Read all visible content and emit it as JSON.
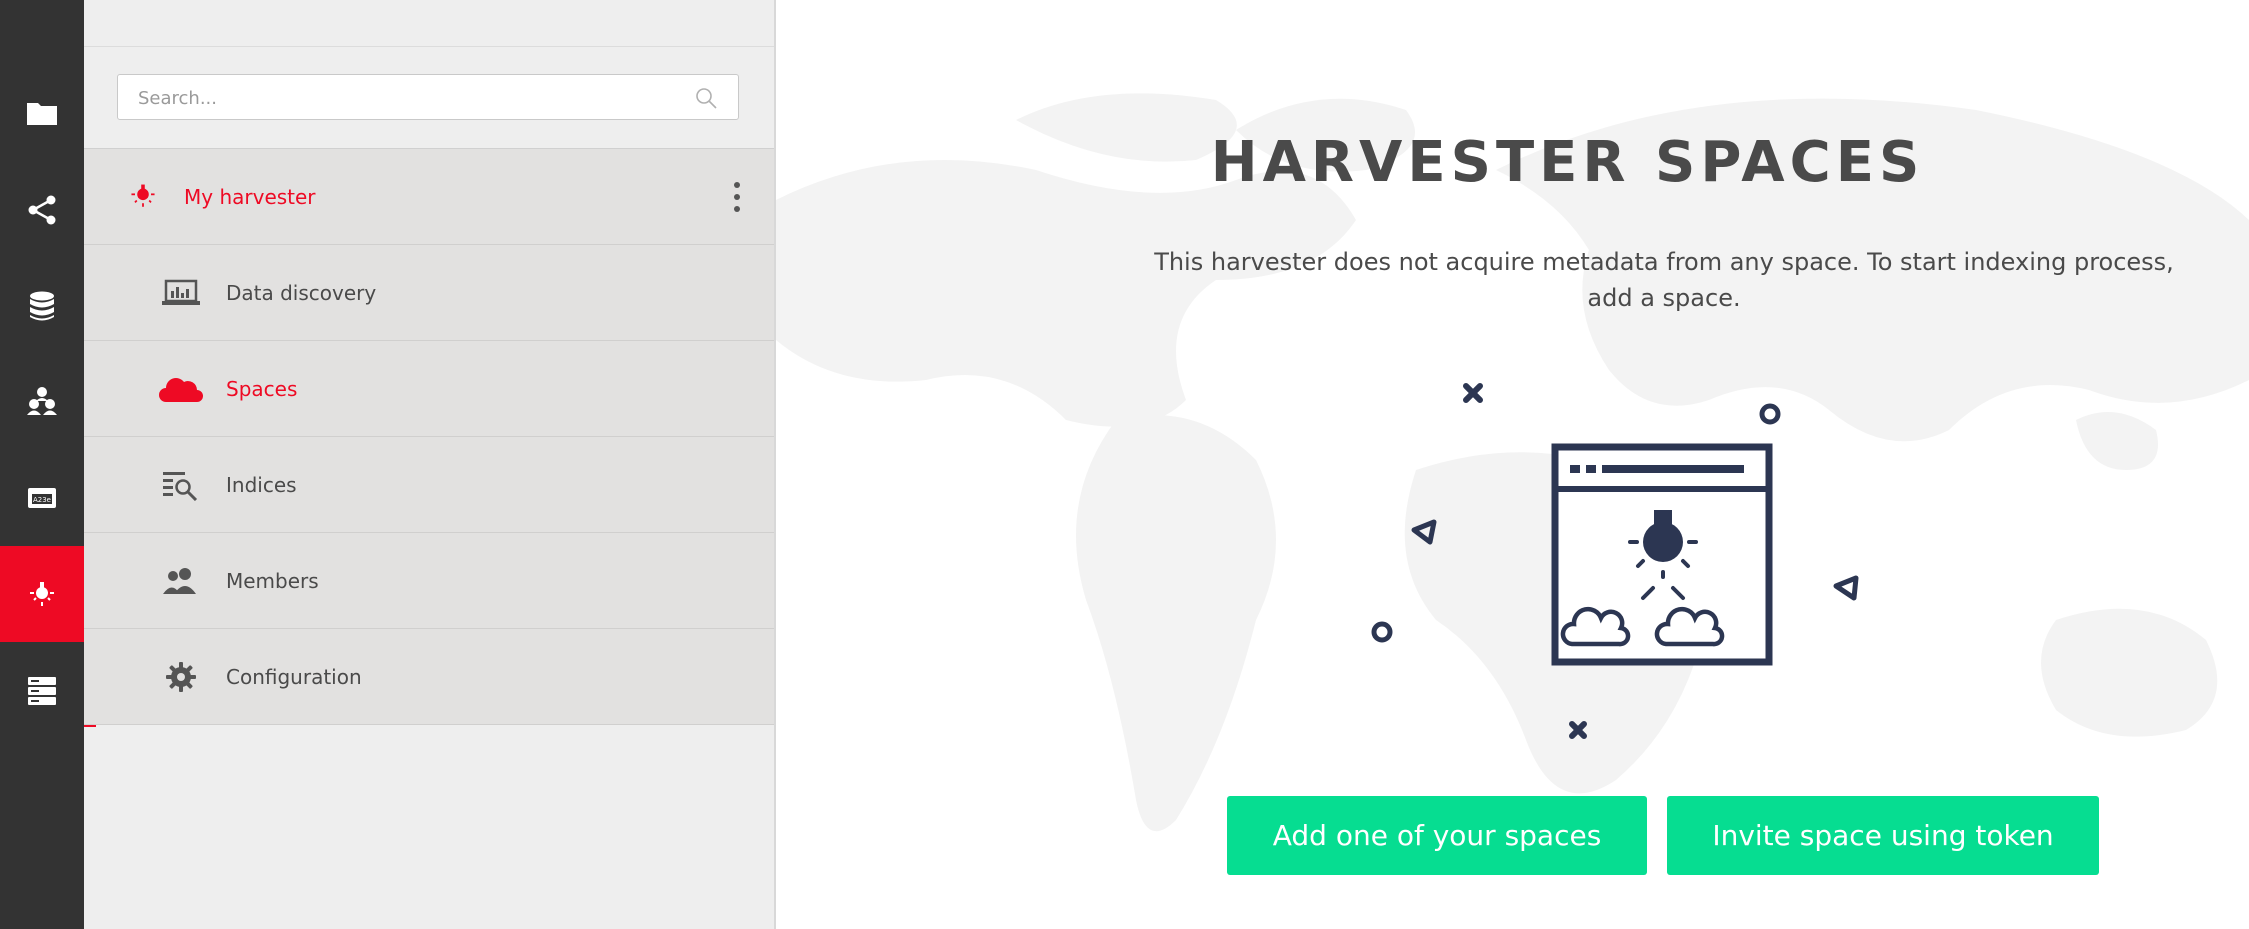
{
  "rail": {
    "items": [
      {
        "icon": "folder-icon",
        "active": false
      },
      {
        "icon": "share-icon",
        "active": false
      },
      {
        "icon": "database-icon",
        "active": false
      },
      {
        "icon": "groups-icon",
        "active": false
      },
      {
        "icon": "token-icon",
        "active": false
      },
      {
        "icon": "harvester-icon",
        "active": true
      },
      {
        "icon": "server-icon",
        "active": false
      }
    ],
    "token_text": "A23e",
    "active_color": "#ee0a24"
  },
  "sidebar": {
    "search_placeholder": "Search...",
    "harvester": {
      "label": "My harvester",
      "icon": "harvester-icon"
    },
    "items": [
      {
        "label": "Data discovery",
        "icon": "data-discovery-icon",
        "selected": false
      },
      {
        "label": "Spaces",
        "icon": "cloud-icon",
        "selected": true
      },
      {
        "label": "Indices",
        "icon": "indices-icon",
        "selected": false
      },
      {
        "label": "Members",
        "icon": "members-icon",
        "selected": false
      },
      {
        "label": "Configuration",
        "icon": "gear-icon",
        "selected": false
      }
    ]
  },
  "main": {
    "title": "HARVESTER SPACES",
    "description": "This harvester does not acquire metadata from any space. To start indexing process, add a space.",
    "add_button": "Add one of your spaces",
    "invite_button": "Invite space using token",
    "button_color": "#06dd91"
  }
}
